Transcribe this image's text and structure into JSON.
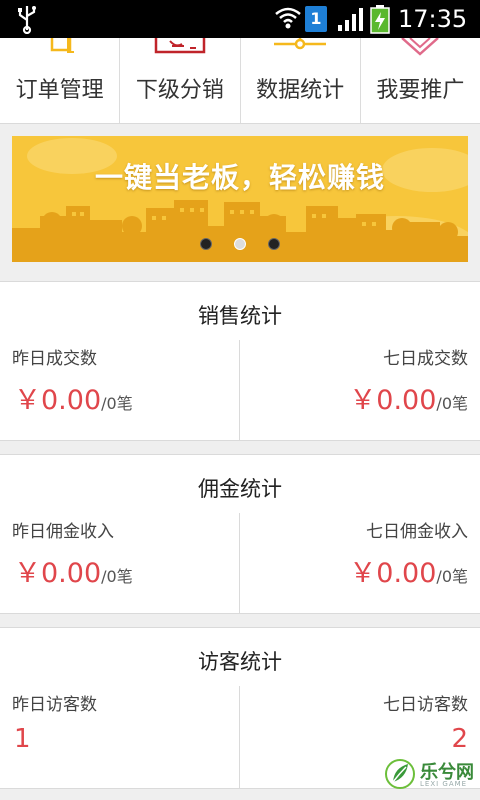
{
  "statusbar": {
    "time": "17:35",
    "sim_badge": "1",
    "icons": [
      "usb-icon",
      "wifi-icon",
      "sim-icon",
      "signal-icon",
      "battery-charging-icon"
    ]
  },
  "menu": {
    "items": [
      {
        "label": "订单管理",
        "icon": "order-icon"
      },
      {
        "label": "下级分销",
        "icon": "distribution-icon"
      },
      {
        "label": "数据统计",
        "icon": "statistics-icon"
      },
      {
        "label": "我要推广",
        "icon": "promote-icon"
      }
    ]
  },
  "banner": {
    "text": "一键当老板，轻松赚钱",
    "slide_count": 3,
    "active_slide": 2
  },
  "sales": {
    "title": "销售统计",
    "yesterday_label": "昨日成交数",
    "yesterday_amount": "￥0.00",
    "yesterday_count": "/0笔",
    "week_label": "七日成交数",
    "week_amount": "￥0.00",
    "week_count": "/0笔"
  },
  "commission": {
    "title": "佣金统计",
    "yesterday_label": "昨日佣金收入",
    "yesterday_amount": "￥0.00",
    "yesterday_count": "/0笔",
    "week_label": "七日佣金收入",
    "week_amount": "￥0.00",
    "week_count": "/0笔"
  },
  "visitors": {
    "title": "访客统计",
    "yesterday_label": "昨日访客数",
    "yesterday_value": "1",
    "week_label": "七日访客数",
    "week_value": "2"
  },
  "watermark": {
    "text": "乐兮网",
    "sub": "LEXI GAME"
  },
  "colors": {
    "accent": "#e0464b",
    "banner": "#f7c63b",
    "statusbar": "#000000"
  }
}
